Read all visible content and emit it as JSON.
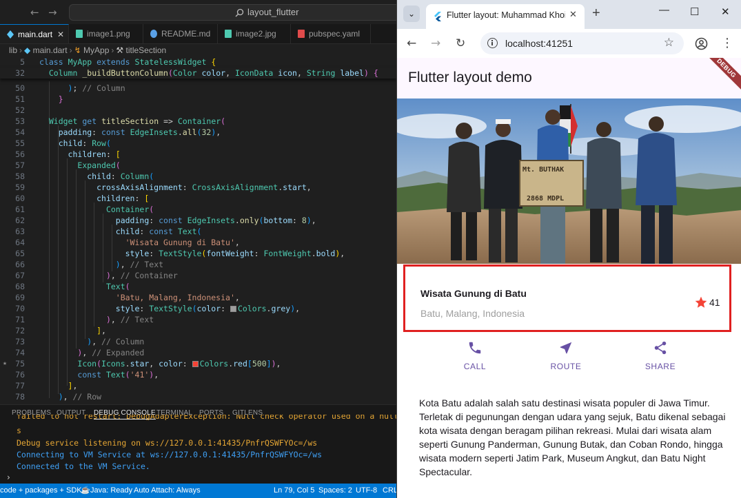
{
  "vscode": {
    "search_text": "layout_flutter",
    "tabs": [
      {
        "label": "main.dart",
        "color": "#5cc7f7"
      },
      {
        "label": "image1.png",
        "color": "#4ec9b0"
      },
      {
        "label": "README.md",
        "color": "#5aa0e6"
      },
      {
        "label": "image2.jpg",
        "color": "#4ec9b0"
      },
      {
        "label": "pubspec.yaml",
        "color": "#e04b4b"
      }
    ],
    "breadcrumb": [
      "lib",
      "main.dart",
      "MyApp",
      "titleSection"
    ],
    "line_numbers": [
      "5",
      "32",
      "50",
      "51",
      "52",
      "53",
      "54",
      "55",
      "56",
      "57",
      "58",
      "59",
      "60",
      "61",
      "62",
      "63",
      "64",
      "65",
      "66",
      "67",
      "68",
      "69",
      "70",
      "71",
      "72",
      "73",
      "74",
      "75",
      "76",
      "77",
      "78"
    ],
    "panel_tabs": [
      "PROBLEMS",
      "OUTPUT",
      "DEBUG CONSOLE",
      "TERMINAL",
      "PORTS",
      "GITLENS"
    ],
    "console": {
      "line1": "failed to hot restart: DebugAdapterException: Null check operator used on a null value",
      "line2": "s",
      "line3": "Debug service listening on ws://127.0.0.1:41435/PnfrQSWFYOc=/ws",
      "line4": "Connecting to VM Service at ws://127.0.0.1:41435/PnfrQSWFYOc=/ws",
      "line5": "Connected to the VM Service."
    },
    "status": {
      "left": "code + packages + SDK",
      "java": "Java: Ready",
      "attach": "Auto Attach: Always",
      "position": "Ln 79, Col 5",
      "spaces": "Spaces: 2",
      "encoding": "UTF-8",
      "eol": "CRLF"
    }
  },
  "chrome": {
    "tab_title": "Flutter layout: Muhammad Khoi",
    "url": "localhost:41251"
  },
  "flutter": {
    "appbar_title": "Flutter layout demo",
    "debug_banner": "DEBUG",
    "title_section": {
      "name": "Wisata Gunung di Batu",
      "location": "Batu, Malang, Indonesia",
      "star_count": "41"
    },
    "buttons": [
      {
        "label": "CALL",
        "icon": "phone-icon"
      },
      {
        "label": "ROUTE",
        "icon": "near-me-icon"
      },
      {
        "label": "SHARE",
        "icon": "share-icon"
      }
    ],
    "accent_color": "#6750a4",
    "star_color": "#f44336",
    "highlight_border_color": "#e02020",
    "photo": {
      "sign_line1": "Mt. BUTHAK",
      "sign_line2": "2868 MDPL"
    },
    "description": "Kota Batu adalah salah satu destinasi wisata populer di Jawa Timur. Terletak di pegunungan dengan udara yang sejuk, Batu dikenal sebagai kota wisata dengan beragam pilihan rekreasi. Mulai dari wisata alam seperti Gunung Panderman, Gunung Butak, dan Coban Rondo, hingga wisata modern seperti Jatim Park, Museum Angkut, dan Batu Night Spectacular."
  }
}
